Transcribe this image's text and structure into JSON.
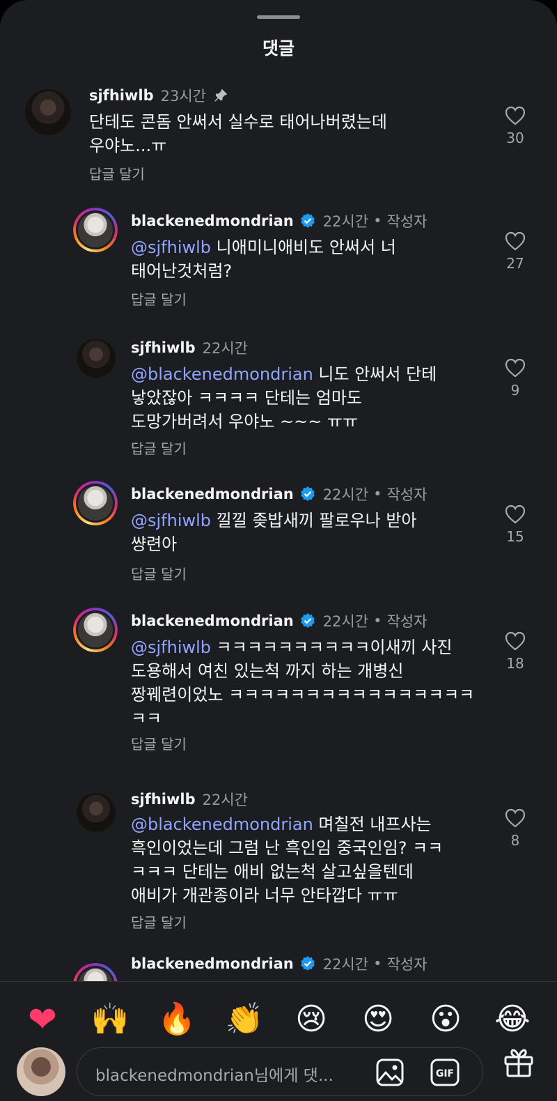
{
  "sheet": {
    "title": "댓글"
  },
  "comments": [
    {
      "user": "sjfhiwlb",
      "time": "23시간",
      "pinned": true,
      "author": "",
      "mention": "",
      "text": "단테도 콘돔 안써서 실수로 태어나버렸는데\n우야노...ㅠ",
      "reply": "답글 달기",
      "likes": "30"
    },
    {
      "user": "blackenedmondrian",
      "time": "22시간",
      "author": "작성자",
      "mention": "@sjfhiwlb",
      "text": " 니애미니애비도 안써서 너\n태어난것처럼?",
      "reply": "답글 달기",
      "likes": "27"
    },
    {
      "user": "sjfhiwlb",
      "time": "22시간",
      "author": "",
      "mention": "@blackenedmondrian",
      "text": " 니도 안써서 단테\n낳았잖아 ㅋㅋㅋㅋ 단테는 엄마도\n도망가버려서 우야노 ~~~ ㅠㅠ",
      "reply": "답글 달기",
      "likes": "9"
    },
    {
      "user": "blackenedmondrian",
      "time": "22시간",
      "author": "작성자",
      "mention": "@sjfhiwlb",
      "text": " 낄낄 좆밥새끼 팔로우나 받아\n썅련아",
      "reply": "답글 달기",
      "likes": "15"
    },
    {
      "user": "blackenedmondrian",
      "time": "22시간",
      "author": "작성자",
      "mention": "@sjfhiwlb",
      "text": " ㅋㅋㅋㅋㅋㅋㅋㅋㅋㅋ이새끼 사진\n도용해서 여친 있는척 까지 하는 개병신\n짱꿰련이었노 ㅋㅋㅋㅋㅋㅋㅋㅋㅋㅋㅋㅋㅋㅋㅋㅋ\nㅋㅋ",
      "reply": "답글 달기",
      "likes": "18"
    },
    {
      "user": "sjfhiwlb",
      "time": "22시간",
      "author": "",
      "mention": "@blackenedmondrian",
      "text": " 며칠전 내프사는\n흑인이었는데 그럼 난 흑인임 중국인임? ㅋㅋ\nㅋㅋㅋ 단테는 애비 없는척 살고싶을텐데\n애비가 개관종이라 너무 안타깝다 ㅠㅠ",
      "reply": "답글 달기",
      "likes": "8"
    },
    {
      "user": "blackenedmondrian",
      "time": "22시간",
      "author": "작성자"
    }
  ],
  "reactions": [
    "❤",
    "🙌",
    "🔥",
    "👏",
    "😢",
    "😍",
    "😮",
    "😂"
  ],
  "composer": {
    "placeholder": "blackenedmondrian님에게 댓..."
  },
  "icons": {
    "pin": "pin-icon",
    "verified": "verified-badge-icon",
    "like": "heart-outline-icon",
    "image": "image-icon",
    "gif": "gif-icon",
    "gift": "gift-icon"
  },
  "colors": {
    "background": "#1c1d21",
    "mention": "#8ea5ff",
    "verified": "#1d9bf0",
    "muted": "#a8a8ad"
  }
}
